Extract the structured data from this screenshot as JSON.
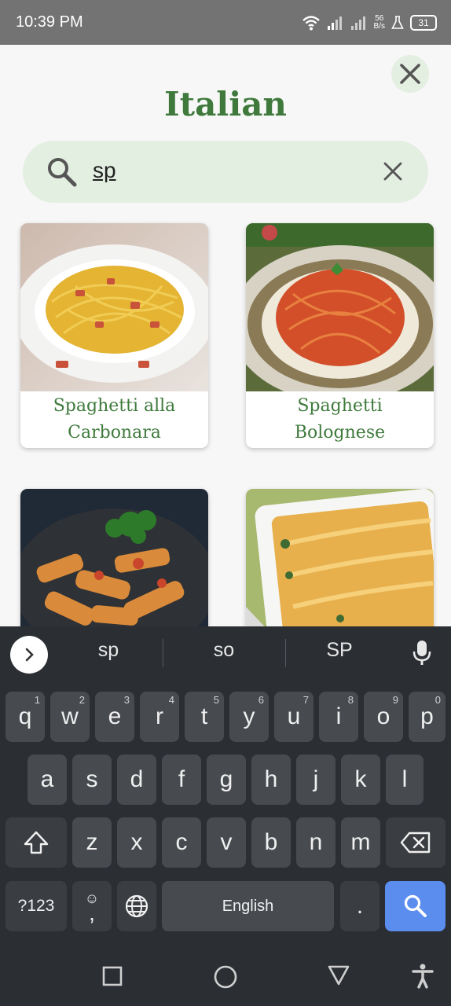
{
  "status": {
    "time": "10:39 PM",
    "net_speed_value": "56",
    "net_speed_unit": "B/s",
    "battery": "31"
  },
  "page": {
    "title": "Italian"
  },
  "search": {
    "value": "sp"
  },
  "recipes": [
    {
      "line1": "Spaghetti alla",
      "line2": "Carbonara"
    },
    {
      "line1": "Spaghetti",
      "line2": "Bolognese"
    },
    {
      "line1": "",
      "line2": ""
    },
    {
      "line1": "",
      "line2": ""
    }
  ],
  "keyboard": {
    "suggestions": [
      "sp",
      "so",
      "SP"
    ],
    "row1": [
      {
        "key": "q",
        "hint": "1"
      },
      {
        "key": "w",
        "hint": "2"
      },
      {
        "key": "e",
        "hint": "3"
      },
      {
        "key": "r",
        "hint": "4"
      },
      {
        "key": "t",
        "hint": "5"
      },
      {
        "key": "y",
        "hint": "6"
      },
      {
        "key": "u",
        "hint": "7"
      },
      {
        "key": "i",
        "hint": "8"
      },
      {
        "key": "o",
        "hint": "9"
      },
      {
        "key": "p",
        "hint": "0"
      }
    ],
    "row2": [
      "a",
      "s",
      "d",
      "f",
      "g",
      "h",
      "j",
      "k",
      "l"
    ],
    "row3": [
      "z",
      "x",
      "c",
      "v",
      "b",
      "n",
      "m"
    ],
    "symbols_label": "?123",
    "comma_label": ",",
    "space_label": "English",
    "period_label": "."
  },
  "colors": {
    "accent_green": "#3f7a3c",
    "search_bg": "#e3efe0",
    "keyboard_bg": "#2b2e33",
    "key_bg": "#474b50",
    "search_key": "#5b8def"
  }
}
